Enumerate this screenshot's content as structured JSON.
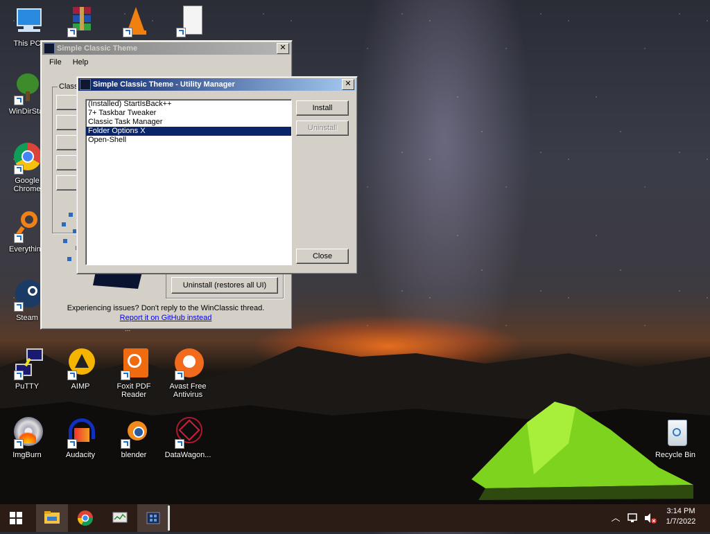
{
  "desktop_icons": [
    {
      "id": "this-pc",
      "label": "This PC"
    },
    {
      "id": "winrar",
      "label": ""
    },
    {
      "id": "vlc",
      "label": ""
    },
    {
      "id": "file",
      "label": ""
    },
    {
      "id": "windirstat",
      "label": "WinDirStat"
    },
    {
      "id": "chrome",
      "label": "Google Chrome"
    },
    {
      "id": "everything",
      "label": "Everything"
    },
    {
      "id": "steam",
      "label": "Steam"
    },
    {
      "id": "putty",
      "label": "PuTTY"
    },
    {
      "id": "aimp",
      "label": "AIMP"
    },
    {
      "id": "foxit",
      "label": "Foxit PDF Reader"
    },
    {
      "id": "avast",
      "label": "Avast Free Antivirus"
    },
    {
      "id": "imgburn",
      "label": "ImgBurn"
    },
    {
      "id": "audacity",
      "label": "Audacity"
    },
    {
      "id": "blender",
      "label": "blender"
    },
    {
      "id": "datawagon",
      "label": "DataWagon..."
    },
    {
      "id": "recycle-bin",
      "label": "Recycle Bin"
    }
  ],
  "back_window": {
    "title": "Simple Classic Theme",
    "menu": [
      "File",
      "Help"
    ],
    "group_label": "Class",
    "uninstall_button": "Uninstall (restores all UI)",
    "issue_text": "Experiencing issues? Don't reply to the WinClassic thread.",
    "github_link": "Report it on GitHub instead",
    "partial_text": "..."
  },
  "utility_manager": {
    "title": "Simple Classic Theme - Utility Manager",
    "items": [
      "(Installed) StartIsBack++",
      "7+ Taskbar Tweaker",
      "Classic Task Manager",
      "Folder Options X",
      "Open-Shell"
    ],
    "selected_index": 3,
    "install_label": "Install",
    "uninstall_label": "Uninstall",
    "close_label": "Close"
  },
  "taskbar": {
    "time": "3:14 PM",
    "date": "1/7/2022"
  }
}
